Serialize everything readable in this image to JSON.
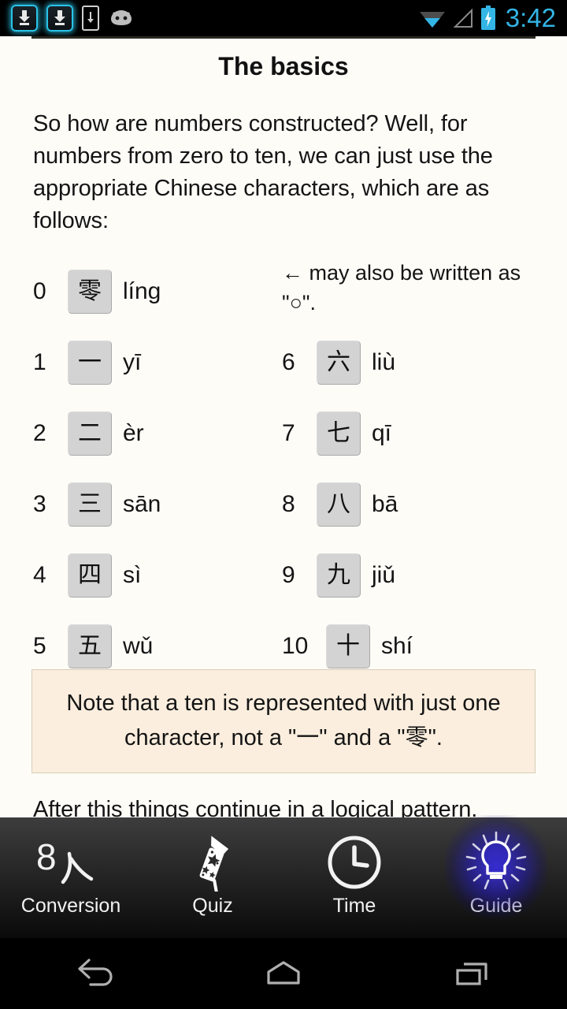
{
  "status_bar": {
    "time": "3:42",
    "accent_color": "#33b5e5",
    "left_icons": [
      {
        "name": "download-complete-badge-icon"
      },
      {
        "name": "download-complete-badge-icon"
      },
      {
        "name": "phone-download-icon"
      },
      {
        "name": "android-mascot-icon"
      }
    ],
    "right_icons": [
      {
        "name": "wifi-icon"
      },
      {
        "name": "cell-signal-icon"
      },
      {
        "name": "battery-charging-icon"
      }
    ]
  },
  "content": {
    "title": "The basics",
    "intro_paragraph": "So how are numbers constructed? Well, for numbers from zero to ten, we can just use the appropriate Chinese characters, which are as follows:",
    "side_note": "← may also be written as \"○\".",
    "numbers_left": [
      {
        "digit": "0",
        "char": "零",
        "pinyin": "líng"
      },
      {
        "digit": "1",
        "char": "一",
        "pinyin": "yī"
      },
      {
        "digit": "2",
        "char": "二",
        "pinyin": "èr"
      },
      {
        "digit": "3",
        "char": "三",
        "pinyin": "sān"
      },
      {
        "digit": "4",
        "char": "四",
        "pinyin": "sì"
      },
      {
        "digit": "5",
        "char": "五",
        "pinyin": "wǔ"
      }
    ],
    "numbers_right": [
      {
        "digit": "6",
        "char": "六",
        "pinyin": "liù"
      },
      {
        "digit": "7",
        "char": "七",
        "pinyin": "qī"
      },
      {
        "digit": "8",
        "char": "八",
        "pinyin": "bā"
      },
      {
        "digit": "9",
        "char": "九",
        "pinyin": "jiǔ"
      },
      {
        "digit": "10",
        "char": "十",
        "pinyin": "shí"
      }
    ],
    "note_box": "Note that a ten is represented with just one character, not a \"一\" and a \"零\".",
    "after_paragraph": "After this things continue in a logical pattern.",
    "note_box_bg": "#fbeede",
    "note_box_border": "#d8cdb8",
    "char_box_bg": "#d3d3d3"
  },
  "tabs": [
    {
      "label": "Conversion",
      "icon": "conversion-icon",
      "active": false
    },
    {
      "label": "Quiz",
      "icon": "firework-icon",
      "active": false
    },
    {
      "label": "Time",
      "icon": "clock-icon",
      "active": false
    },
    {
      "label": "Guide",
      "icon": "lightbulb-icon",
      "active": true
    }
  ],
  "nav_bar": {
    "back": "back-icon",
    "home": "home-icon",
    "recents": "recents-icon"
  }
}
